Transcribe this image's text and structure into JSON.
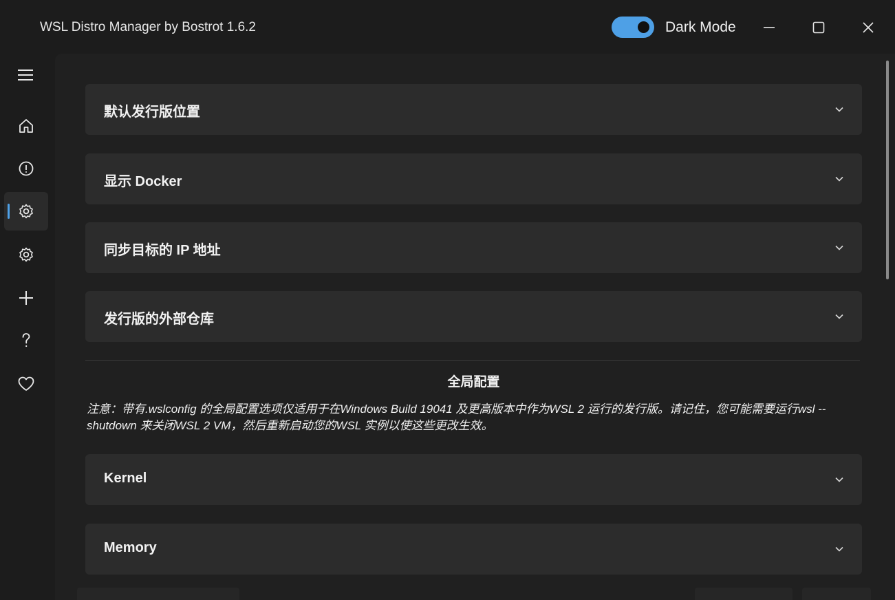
{
  "window": {
    "title": "WSL Distro Manager by Bostrot 1.6.2",
    "theme_toggle": {
      "label": "Dark Mode",
      "state": "on",
      "accent_color": "#4ea0e6"
    },
    "controls": [
      "minimize",
      "maximize",
      "close"
    ]
  },
  "sidebar": {
    "menu_icon": "hamburger-menu-icon",
    "items": [
      {
        "icon": "home-icon",
        "active": false
      },
      {
        "icon": "info-icon",
        "active": false
      },
      {
        "icon": "settings-icon",
        "active": true
      },
      {
        "icon": "settings-icon",
        "active": false
      },
      {
        "icon": "plus-icon",
        "active": false
      },
      {
        "icon": "question-mark-icon",
        "active": false
      },
      {
        "icon": "heart-icon",
        "active": false
      }
    ]
  },
  "settings": {
    "expanders": [
      {
        "label": "默认发行版位置"
      },
      {
        "label": "显示 Docker"
      },
      {
        "label": "同步目标的 IP 地址"
      },
      {
        "label": "发行版的外部仓库"
      }
    ],
    "global_section_title": "全局配置",
    "global_note": "注意：带有.wslconfig 的全局配置选项仅适用于在Windows Build 19041 及更高版本中作为WSL 2 运行的发行版。请记住，您可能需要运行wsl --shutdown 来关闭WSL 2 VM，然后重新启动您的WSL 实例以使这些更改生效。",
    "global_expanders": [
      {
        "label": "Kernel"
      },
      {
        "label": "Memory"
      }
    ]
  }
}
